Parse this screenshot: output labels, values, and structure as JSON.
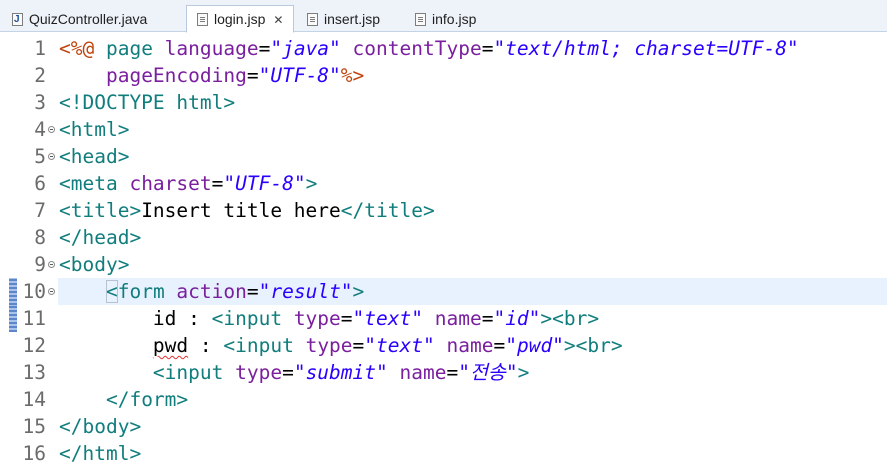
{
  "tabs": [
    {
      "label": "QuizController.java",
      "icon": "java-file-icon",
      "active": false
    },
    {
      "label": "login.jsp",
      "icon": "jsp-file-icon",
      "active": true
    },
    {
      "label": "insert.jsp",
      "icon": "jsp-file-icon",
      "active": false
    },
    {
      "label": "info.jsp",
      "icon": "jsp-file-icon",
      "active": false
    }
  ],
  "editor": {
    "current_line": 10,
    "lines": [
      {
        "num": "1",
        "indent": "",
        "tokens": [
          {
            "t": "<%@ ",
            "c": "dir"
          },
          {
            "t": "page ",
            "c": "tag"
          },
          {
            "t": "language",
            "c": "attr"
          },
          {
            "t": "=",
            "c": "txt"
          },
          {
            "t": "\"java\"",
            "c": "val"
          },
          {
            "t": " ",
            "c": "txt"
          },
          {
            "t": "contentType",
            "c": "attr"
          },
          {
            "t": "=",
            "c": "txt"
          },
          {
            "t": "\"text/html; charset=UTF-8\"",
            "c": "val"
          }
        ]
      },
      {
        "num": "2",
        "indent": "    ",
        "tokens": [
          {
            "t": "pageEncoding",
            "c": "attr"
          },
          {
            "t": "=",
            "c": "txt"
          },
          {
            "t": "\"UTF-8\"",
            "c": "val"
          },
          {
            "t": "%>",
            "c": "dir"
          }
        ]
      },
      {
        "num": "3",
        "indent": "",
        "tokens": [
          {
            "t": "<!DOCTYPE ",
            "c": "tag"
          },
          {
            "t": "html",
            "c": "tag"
          },
          {
            "t": ">",
            "c": "tag"
          }
        ]
      },
      {
        "num": "4",
        "fold": true,
        "indent": "",
        "tokens": [
          {
            "t": "<html>",
            "c": "tag"
          }
        ]
      },
      {
        "num": "5",
        "fold": true,
        "indent": "",
        "tokens": [
          {
            "t": "<head>",
            "c": "tag"
          }
        ]
      },
      {
        "num": "6",
        "indent": "",
        "tokens": [
          {
            "t": "<meta ",
            "c": "tag"
          },
          {
            "t": "charset",
            "c": "attr"
          },
          {
            "t": "=",
            "c": "txt"
          },
          {
            "t": "\"UTF-8\"",
            "c": "val"
          },
          {
            "t": ">",
            "c": "tag"
          }
        ]
      },
      {
        "num": "7",
        "indent": "",
        "tokens": [
          {
            "t": "<title>",
            "c": "tag"
          },
          {
            "t": "Insert title here",
            "c": "txt"
          },
          {
            "t": "</title>",
            "c": "tag"
          }
        ]
      },
      {
        "num": "8",
        "indent": "",
        "tokens": [
          {
            "t": "</head>",
            "c": "tag"
          }
        ]
      },
      {
        "num": "9",
        "fold": true,
        "indent": "",
        "tokens": [
          {
            "t": "<body>",
            "c": "tag"
          }
        ]
      },
      {
        "num": "10",
        "fold": true,
        "marker": true,
        "indent": "    ",
        "tokens": [
          {
            "t": "<",
            "c": "tag caret-box"
          },
          {
            "t": "form ",
            "c": "tag"
          },
          {
            "t": "action",
            "c": "attr"
          },
          {
            "t": "=",
            "c": "txt"
          },
          {
            "t": "\"result\"",
            "c": "val"
          },
          {
            "t": ">",
            "c": "tag"
          }
        ]
      },
      {
        "num": "11",
        "marker": true,
        "indent": "        ",
        "tokens": [
          {
            "t": "id : ",
            "c": "txt"
          },
          {
            "t": "<input ",
            "c": "tag"
          },
          {
            "t": "type",
            "c": "attr"
          },
          {
            "t": "=",
            "c": "txt"
          },
          {
            "t": "\"text\"",
            "c": "val"
          },
          {
            "t": " ",
            "c": "txt"
          },
          {
            "t": "name",
            "c": "attr"
          },
          {
            "t": "=",
            "c": "txt"
          },
          {
            "t": "\"id\"",
            "c": "val"
          },
          {
            "t": "><br>",
            "c": "tag"
          }
        ]
      },
      {
        "num": "12",
        "indent": "        ",
        "tokens": [
          {
            "t": "pwd",
            "c": "txt squiggle"
          },
          {
            "t": " : ",
            "c": "txt"
          },
          {
            "t": "<input ",
            "c": "tag"
          },
          {
            "t": "type",
            "c": "attr"
          },
          {
            "t": "=",
            "c": "txt"
          },
          {
            "t": "\"text\"",
            "c": "val"
          },
          {
            "t": " ",
            "c": "txt"
          },
          {
            "t": "name",
            "c": "attr"
          },
          {
            "t": "=",
            "c": "txt"
          },
          {
            "t": "\"pwd\"",
            "c": "val"
          },
          {
            "t": "><br>",
            "c": "tag"
          }
        ]
      },
      {
        "num": "13",
        "indent": "        ",
        "tokens": [
          {
            "t": "<input ",
            "c": "tag"
          },
          {
            "t": "type",
            "c": "attr"
          },
          {
            "t": "=",
            "c": "txt"
          },
          {
            "t": "\"submit\"",
            "c": "val"
          },
          {
            "t": " ",
            "c": "txt"
          },
          {
            "t": "name",
            "c": "attr"
          },
          {
            "t": "=",
            "c": "txt"
          },
          {
            "t": "\"전송\"",
            "c": "val"
          },
          {
            "t": ">",
            "c": "tag"
          }
        ]
      },
      {
        "num": "14",
        "indent": "    ",
        "tokens": [
          {
            "t": "</form>",
            "c": "tag"
          }
        ]
      },
      {
        "num": "15",
        "indent": "",
        "tokens": [
          {
            "t": "</body>",
            "c": "tag"
          }
        ]
      },
      {
        "num": "16",
        "indent": "",
        "tokens": [
          {
            "t": "</html>",
            "c": "tag"
          }
        ]
      }
    ]
  }
}
